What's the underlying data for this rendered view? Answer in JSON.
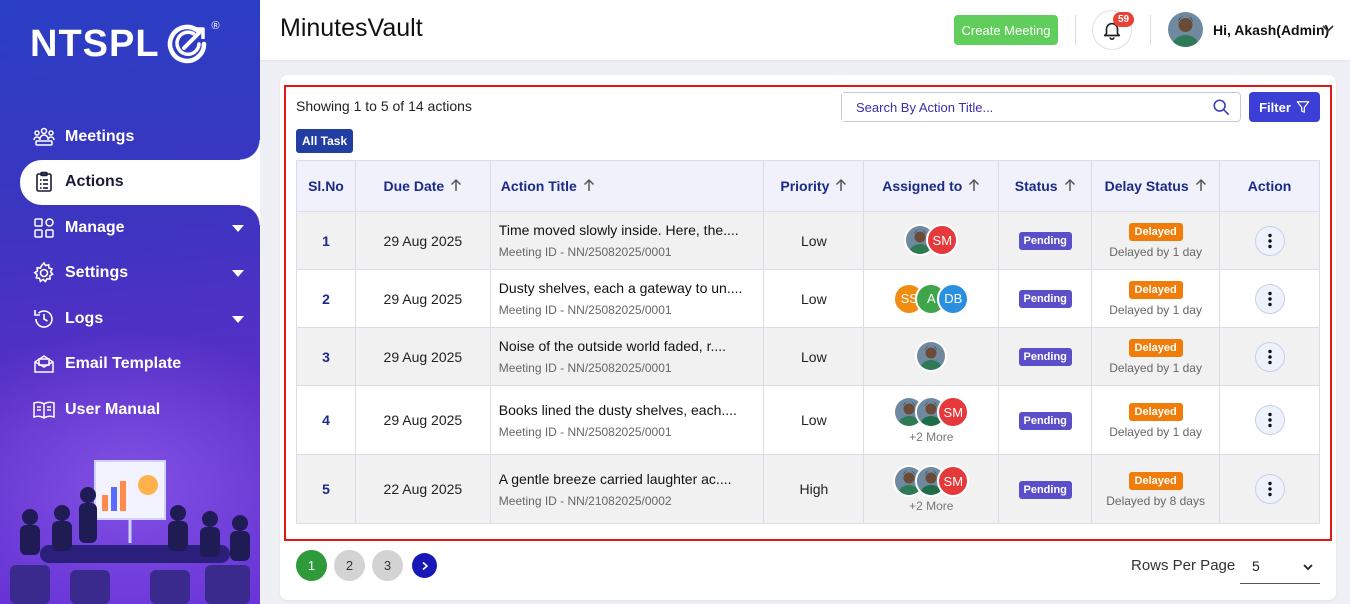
{
  "sidebar": {
    "logo": "NTSPL",
    "items": [
      {
        "label": "Meetings",
        "icon": "meetings-icon",
        "caret": false,
        "active": false
      },
      {
        "label": "Actions",
        "icon": "clipboard-icon",
        "caret": false,
        "active": true
      },
      {
        "label": "Manage",
        "icon": "grid-icon",
        "caret": true,
        "active": false
      },
      {
        "label": "Settings",
        "icon": "gear-icon",
        "caret": true,
        "active": false
      },
      {
        "label": "Logs",
        "icon": "history-icon",
        "caret": true,
        "active": false
      },
      {
        "label": "Email Template",
        "icon": "envelope-icon",
        "caret": false,
        "active": false
      },
      {
        "label": "User Manual",
        "icon": "book-icon",
        "caret": false,
        "active": false
      }
    ]
  },
  "header": {
    "title": "MinutesVault",
    "create_button": "Create Meeting",
    "notification_count": "59",
    "user_greeting": "Hi, Akash(Admin)"
  },
  "toolbar": {
    "showing": "Showing 1 to 5 of 14 actions",
    "tab": "All Task",
    "search_placeholder": "Search By Action Title...",
    "filter_label": "Filter"
  },
  "table": {
    "headers": [
      "Sl.No",
      "Due Date",
      "Action Title",
      "Priority",
      "Assigned to",
      "Status",
      "Delay Status",
      "Action"
    ],
    "rows": [
      {
        "sl": "1",
        "due": "29 Aug 2025",
        "title": "Time moved slowly inside. Here, the....",
        "meeting": "Meeting ID - NN/25082025/0001",
        "priority": "Low",
        "assignees": [
          {
            "type": "photo"
          },
          {
            "type": "initials",
            "text": "SM",
            "color": "#e5393b"
          }
        ],
        "more": "",
        "status": "Pending",
        "delay": "Delayed",
        "delay_text": "Delayed by 1 day"
      },
      {
        "sl": "2",
        "due": "29 Aug 2025",
        "title": "Dusty shelves, each a gateway to un....",
        "meeting": "Meeting ID - NN/25082025/0001",
        "priority": "Low",
        "assignees": [
          {
            "type": "initials",
            "text": "SS",
            "color": "#f08c10"
          },
          {
            "type": "initials",
            "text": "A",
            "color": "#3fa54a"
          },
          {
            "type": "initials",
            "text": "DB",
            "color": "#2a8fe0"
          }
        ],
        "more": "",
        "status": "Pending",
        "delay": "Delayed",
        "delay_text": "Delayed by 1 day"
      },
      {
        "sl": "3",
        "due": "29 Aug 2025",
        "title": "Noise of the outside world faded, r....",
        "meeting": "Meeting ID - NN/25082025/0001",
        "priority": "Low",
        "assignees": [
          {
            "type": "photo"
          }
        ],
        "more": "",
        "status": "Pending",
        "delay": "Delayed",
        "delay_text": "Delayed by 1 day"
      },
      {
        "sl": "4",
        "due": "29 Aug 2025",
        "title": "Books lined the dusty shelves, each....",
        "meeting": "Meeting ID - NN/25082025/0001",
        "priority": "Low",
        "assignees": [
          {
            "type": "photo"
          },
          {
            "type": "photo2"
          },
          {
            "type": "initials",
            "text": "SM",
            "color": "#e5393b"
          }
        ],
        "more": "+2 More",
        "status": "Pending",
        "delay": "Delayed",
        "delay_text": "Delayed by 1 day"
      },
      {
        "sl": "5",
        "due": "22 Aug 2025",
        "title": "A gentle breeze carried laughter ac....",
        "meeting": "Meeting ID - NN/21082025/0002",
        "priority": "High",
        "assignees": [
          {
            "type": "photo"
          },
          {
            "type": "photo2"
          },
          {
            "type": "initials",
            "text": "SM",
            "color": "#e5393b"
          }
        ],
        "more": "+2 More",
        "status": "Pending",
        "delay": "Delayed",
        "delay_text": "Delayed by 8 days"
      }
    ]
  },
  "pagination": {
    "pages": [
      "1",
      "2",
      "3"
    ],
    "current": "1",
    "rows_per_page_label": "Rows Per Page",
    "rows_per_page_value": "5"
  },
  "colors": {
    "accent": "#3b3fd6",
    "pending": "#5a4fc8",
    "delayed": "#f07d0a",
    "create": "#5fce5a",
    "frame": "#e01818"
  }
}
